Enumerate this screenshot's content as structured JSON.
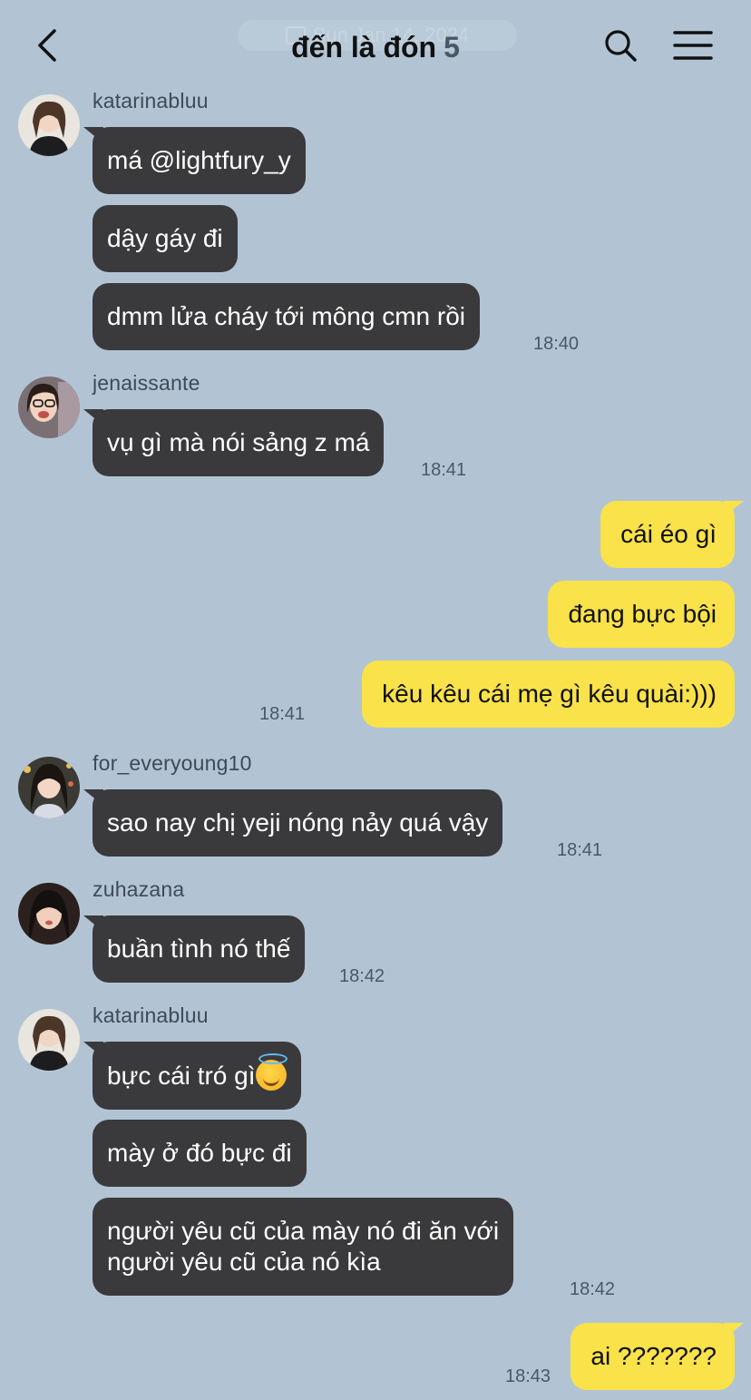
{
  "header": {
    "title": "đến là đón",
    "member_count": "5",
    "date_chip": "Sun Jan 14, 2024",
    "back_icon": "chevron-left-icon",
    "search_icon": "search-icon",
    "menu_icon": "hamburger-menu-icon"
  },
  "colors": {
    "background": "#b2c4d4",
    "incoming_bubble": "#3a3a3c",
    "outgoing_bubble": "#f9e24a"
  },
  "messages": [
    {
      "sender": "katarinabluu",
      "bubbles": [
        "má @lightfury_y",
        "dậy gáy đi",
        "dmm lửa cháy tới mông cmn rồi"
      ],
      "time": "18:40"
    },
    {
      "sender": "jenaissante",
      "bubbles": [
        "vụ gì mà nói sảng z má"
      ],
      "time": "18:41"
    },
    {
      "sender": "me",
      "bubbles": [
        "cái éo gì",
        "đang bực bội",
        "kêu kêu cái mẹ gì kêu quài:)))"
      ],
      "time": "18:41"
    },
    {
      "sender": "for_everyoung10",
      "bubbles": [
        "sao nay chị yeji nóng nảy quá vậy"
      ],
      "time": "18:41"
    },
    {
      "sender": "zuhazana",
      "bubbles": [
        "buần tình nó thế"
      ],
      "time": "18:42"
    },
    {
      "sender": "katarinabluu",
      "bubbles": [
        "bực cái tró gì",
        "mày ở đó bực đi",
        [
          "người yêu cũ của mày nó đi ăn với",
          "người yêu cũ của nó kìa"
        ]
      ],
      "emoji": "smiling-face-with-halo-emoji",
      "time": "18:42"
    },
    {
      "sender": "me",
      "bubbles": [
        "ai ???????"
      ],
      "time": "18:43"
    }
  ]
}
